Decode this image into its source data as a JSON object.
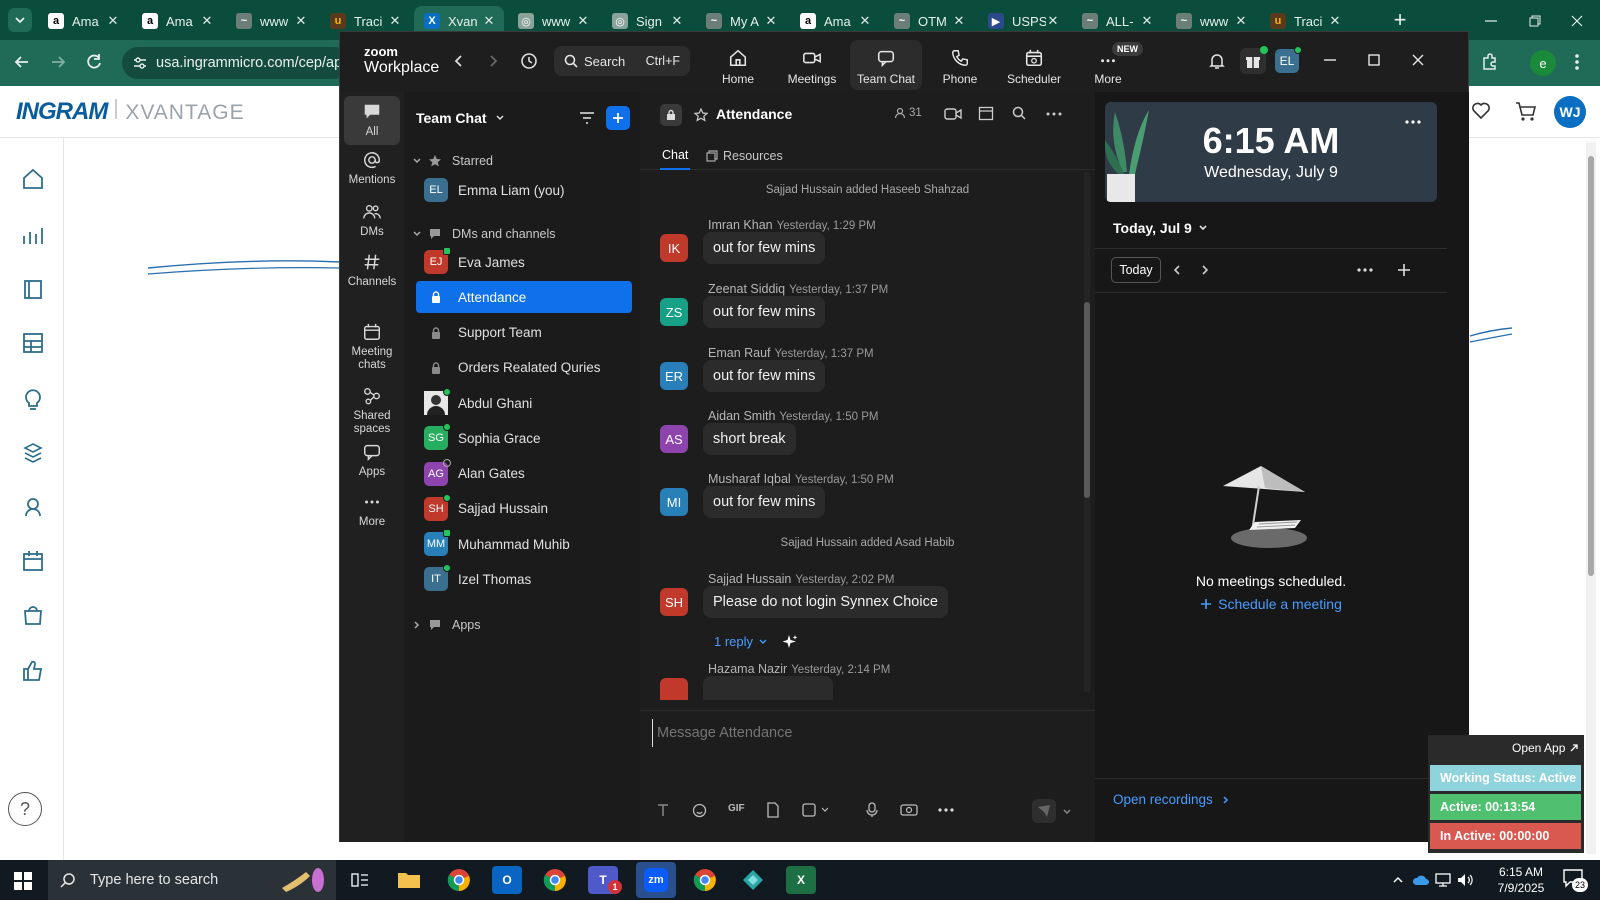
{
  "browser": {
    "tabs": [
      {
        "label": "Ama",
        "icon": "amazon-icon"
      },
      {
        "label": "Ama",
        "icon": "amazon-icon"
      },
      {
        "label": "www",
        "icon": "site-icon"
      },
      {
        "label": "Traci",
        "icon": "ups-icon"
      },
      {
        "label": "Xvan",
        "icon": "xvantage-icon",
        "active": true
      },
      {
        "label": "www",
        "icon": "globe-icon"
      },
      {
        "label": "Sign",
        "icon": "globe-icon"
      },
      {
        "label": "My A",
        "icon": "site-icon"
      },
      {
        "label": "Ama",
        "icon": "amazon-icon"
      },
      {
        "label": "OTM",
        "icon": "site-icon"
      },
      {
        "label": "USPS",
        "icon": "usps-icon"
      },
      {
        "label": "ALL-",
        "icon": "site-icon"
      },
      {
        "label": "www",
        "icon": "site-icon"
      },
      {
        "label": "Traci",
        "icon": "ups-icon"
      }
    ],
    "url": "usa.ingrammicro.com/cep/ap",
    "profile_initial": "e",
    "colors": {
      "tabstrip": "#0b4d3d",
      "toolbar": "#1f6b58"
    }
  },
  "site": {
    "logo_main": "INGRAM",
    "logo_sub": "XVANTAGE",
    "user_initials": "WJ",
    "help_label": "?"
  },
  "zoom": {
    "brand_top": "zoom",
    "brand_bottom": "Workplace",
    "search_label": "Search",
    "search_shortcut": "Ctrl+F",
    "nav": [
      {
        "label": "Home",
        "icon": "home-icon"
      },
      {
        "label": "Meetings",
        "icon": "video-icon"
      },
      {
        "label": "Team Chat",
        "icon": "chat-icon",
        "active": true
      },
      {
        "label": "Phone",
        "icon": "phone-icon"
      },
      {
        "label": "Scheduler",
        "icon": "scheduler-icon"
      },
      {
        "label": "More",
        "icon": "more-icon",
        "badge": "NEW"
      }
    ],
    "user_initials": "EL",
    "rail": [
      {
        "label": "All",
        "icon": "chat-bubble-icon",
        "active": true
      },
      {
        "label": "Mentions",
        "icon": "at-icon"
      },
      {
        "label": "DMs",
        "icon": "people-icon"
      },
      {
        "label": "Channels",
        "icon": "hash-icon"
      },
      {
        "label": "Meeting chats",
        "icon": "calendar-icon"
      },
      {
        "label": "Shared spaces",
        "icon": "share-icon"
      },
      {
        "label": "Apps",
        "icon": "apps-icon"
      },
      {
        "label": "More",
        "icon": "ellipsis-icon"
      }
    ],
    "list": {
      "title": "Team Chat",
      "starred_label": "Starred",
      "starred": [
        {
          "name": "Emma Liam (you)",
          "initials": "EL",
          "color": "#3a6f8f"
        }
      ],
      "dms_label": "DMs and channels",
      "items": [
        {
          "name": "Eva James",
          "initials": "EJ",
          "color": "#c0392b",
          "type": "dm",
          "status": "mobile"
        },
        {
          "name": "Attendance",
          "type": "channel",
          "active": true
        },
        {
          "name": "Support Team",
          "type": "channel"
        },
        {
          "name": "Orders Realated Quries",
          "type": "channel"
        },
        {
          "name": "Abdul Ghani",
          "initials": "AG",
          "color": "#6b6b6b",
          "type": "dm",
          "status": "online",
          "photo": true
        },
        {
          "name": "Sophia Grace",
          "initials": "SG",
          "color": "#27ae60",
          "type": "dm",
          "status": "online"
        },
        {
          "name": "Alan Gates",
          "initials": "AG",
          "color": "#8e44ad",
          "type": "dm",
          "status": "away"
        },
        {
          "name": "Sajjad Hussain",
          "initials": "SH",
          "color": "#c0392b",
          "type": "dm",
          "status": "online"
        },
        {
          "name": "Muhammad Muhib",
          "initials": "MM",
          "color": "#2980b9",
          "type": "dm",
          "status": "mobile"
        },
        {
          "name": "Izel Thomas",
          "initials": "IT",
          "color": "#3a6f8f",
          "type": "dm",
          "status": "online"
        }
      ],
      "apps_label": "Apps"
    },
    "chat": {
      "channel_name": "Attendance",
      "member_count": "31",
      "tabs": [
        {
          "label": "Chat",
          "active": true
        },
        {
          "label": "Resources"
        }
      ],
      "events": [
        {
          "kind": "system",
          "text": "Sajjad Hussain added Haseeb Shahzad"
        },
        {
          "kind": "msg",
          "name": "Imran Khan",
          "time": "Yesterday, 1:29 PM",
          "text": "out for few mins",
          "initials": "IK",
          "color": "#c0392b"
        },
        {
          "kind": "msg",
          "name": "Zeenat Siddiq",
          "time": "Yesterday, 1:37 PM",
          "text": "out for few mins",
          "initials": "ZS",
          "color": "#16a085"
        },
        {
          "kind": "msg",
          "name": "Eman Rauf",
          "time": "Yesterday, 1:37 PM",
          "text": "out for few mins",
          "initials": "ER",
          "color": "#2980b9"
        },
        {
          "kind": "msg",
          "name": "Aidan Smith",
          "time": "Yesterday, 1:50 PM",
          "text": "short break",
          "initials": "AS",
          "color": "#8e44ad"
        },
        {
          "kind": "msg",
          "name": "Musharaf Iqbal",
          "time": "Yesterday, 1:50 PM",
          "text": "out for few mins",
          "initials": "MI",
          "color": "#2980b9"
        },
        {
          "kind": "system",
          "text": "Sajjad Hussain added Asad Habib"
        },
        {
          "kind": "msg",
          "name": "Sajjad Hussain",
          "time": "Yesterday, 2:02 PM",
          "text": "Please do not login Synnex Choice",
          "initials": "SH",
          "color": "#c0392b"
        },
        {
          "kind": "msg",
          "name": "Hazama Nazir",
          "time": "Yesterday, 2:14 PM",
          "text": "",
          "initials": "",
          "color": "#c0392b"
        }
      ],
      "reply_label": "1 reply",
      "composer_placeholder": "Message Attendance"
    },
    "calendar": {
      "time": "6:15 AM",
      "date": "Wednesday, July 9",
      "day_selector": "Today, Jul 9",
      "today_button": "Today",
      "empty_text": "No meetings scheduled.",
      "schedule_link": "Schedule a meeting",
      "recordings_link": "Open recordings"
    }
  },
  "status_widget": {
    "open_app_label": "Open App",
    "working_status": "Working Status: Active",
    "active": "Active: 00:13:54",
    "inactive": "In Active: 00:00:00",
    "colors": {
      "working": "#8fd3dd",
      "active": "#4fc06f",
      "inactive": "#d9584f"
    }
  },
  "taskbar": {
    "search_placeholder": "Type here to search",
    "clock_time": "6:15 AM",
    "clock_date": "7/9/2025",
    "notification_count": "23",
    "teams_badge": "1"
  }
}
